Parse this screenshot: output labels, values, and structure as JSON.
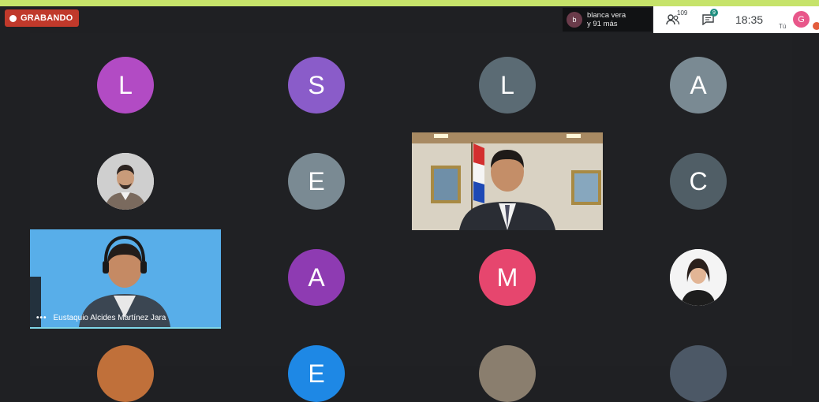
{
  "recording": {
    "label": "GRABANDO"
  },
  "speaker": {
    "initial": "b",
    "line1": "blanca vera",
    "line2": "y 91 más"
  },
  "header": {
    "participants_count": "109",
    "chat_badge": "9",
    "time": "18:35",
    "self_initial": "G",
    "self_label": "Tú"
  },
  "tiles": [
    {
      "initial": "L",
      "color": "#b24bc4"
    },
    {
      "initial": "S",
      "color": "#8a5cc9"
    },
    {
      "initial": "L",
      "color": "#5b6b74"
    },
    {
      "initial": "A",
      "color": "#7a8a93"
    },
    {
      "initial": "E",
      "color": "#7a8a93"
    },
    {
      "initial": "C",
      "color": "#505e66"
    },
    {
      "initial": "A",
      "color": "#8e3bb2"
    },
    {
      "initial": "M",
      "color": "#e6466e"
    },
    {
      "initial": "E",
      "color": "#1e88e5"
    }
  ],
  "active_video": {
    "name": "Eustaquio Alcides Martínez Jara",
    "more": "•••"
  }
}
